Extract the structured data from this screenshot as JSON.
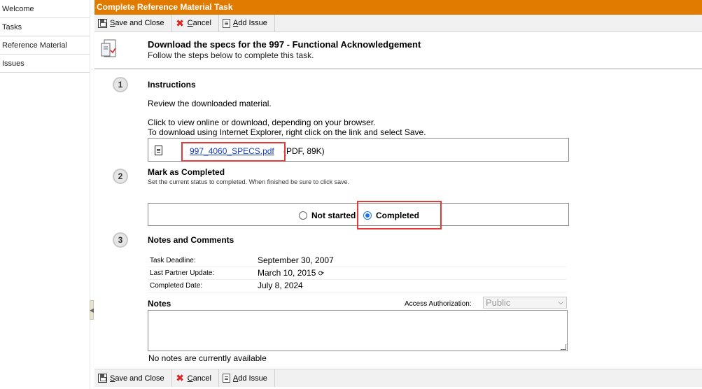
{
  "sidebar": {
    "items": [
      {
        "label": "Welcome"
      },
      {
        "label": "Tasks"
      },
      {
        "label": "Reference Material"
      },
      {
        "label": "Issues"
      }
    ]
  },
  "window": {
    "title": "Complete Reference Material Task"
  },
  "toolbar": {
    "save_first": "S",
    "save_rest": "ave and Close",
    "cancel_first": "C",
    "cancel_rest": "ancel",
    "issue_first": "A",
    "issue_rest": "dd Issue"
  },
  "task": {
    "title": "Download the specs for the 997 - Functional Acknowledgement",
    "subtitle": "Follow the steps below to complete this task."
  },
  "steps": [
    {
      "number": "1",
      "title": "Instructions"
    },
    {
      "number": "2",
      "title": "Mark as Completed",
      "hint": "Set the current status to completed. When finished be sure to click save."
    },
    {
      "number": "3",
      "title": "Notes and Comments"
    }
  ],
  "instructions": {
    "line1": "Review the downloaded material.",
    "line2": "Click to view online or download, depending on your browser.",
    "line3": "To download using Internet Explorer, right click on the link and select Save."
  },
  "file": {
    "name": "997_4060_SPECS.pdf",
    "meta": "(PDF, 89K)"
  },
  "status": {
    "options": [
      "Not started",
      "Completed"
    ],
    "selected": "Completed"
  },
  "details": [
    {
      "label": "Task Deadline:",
      "value": "September 30, 2007"
    },
    {
      "label": "Last Partner Update:",
      "value": "March 10, 2015"
    },
    {
      "label": "Completed Date:",
      "value": "July 8, 2024"
    }
  ],
  "notes": {
    "label": "Notes",
    "access_label": "Access Authorization:",
    "access_value": "Public",
    "empty_text": "No notes are currently available"
  },
  "colors": {
    "title_bar": "#e07b00",
    "highlight": "#e23b3b",
    "link": "#1a3fb8"
  },
  "icons": [
    "floppy-disk-icon",
    "cancel-x-icon",
    "add-issue-icon",
    "task-document-icon",
    "file-icon",
    "sync-icon",
    "collapse-arrow-icon",
    "dropdown-chevron-icon"
  ]
}
